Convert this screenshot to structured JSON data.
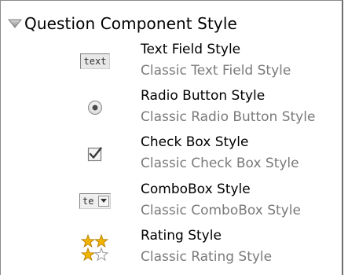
{
  "section": {
    "title": "Question Component Style",
    "expanded_icon": "triangle-down-icon"
  },
  "styles": [
    {
      "name": "Text Field Style",
      "description": "Classic Text Field Style",
      "icon": "text-field-icon",
      "icon_text": "text"
    },
    {
      "name": "Radio Button Style",
      "description": "Classic Radio Button Style",
      "icon": "radio-button-icon"
    },
    {
      "name": "Check Box Style",
      "description": "Classic Check Box Style",
      "icon": "checkbox-icon"
    },
    {
      "name": "ComboBox Style",
      "description": "Classic ComboBox Style",
      "icon": "combobox-icon",
      "icon_text": "te"
    },
    {
      "name": "Rating Style",
      "description": "Classic Rating Style",
      "icon": "rating-stars-icon"
    }
  ],
  "colors": {
    "title_text": "#000000",
    "description_text": "#7a7a7a",
    "star_gold": "#f0b400",
    "triangle": "#8c8c8c"
  }
}
